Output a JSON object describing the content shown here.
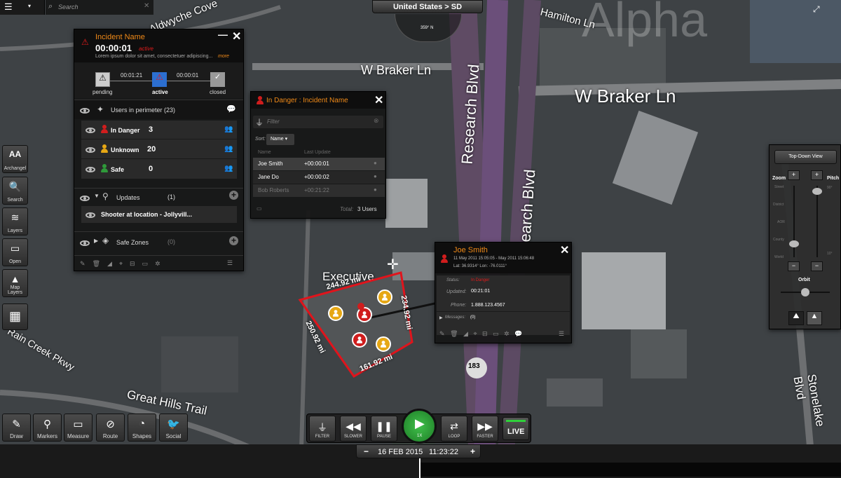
{
  "header": {
    "search_placeholder": "Search",
    "location": "United States > SD",
    "compass_heading": "359° N"
  },
  "map": {
    "watermark": "Alpha",
    "streets": [
      "Hamilton Ln",
      "W Braker Ln",
      "W Braker Ln",
      "Research Blvd",
      "Research Blvd",
      "Stonelake Blvd",
      "Great Hills Trail",
      "Rain Creek Pkwy",
      "Executive",
      "Aldwyche Cove"
    ],
    "highway_shield": "183",
    "perimeter_labels": [
      "244.92 mi",
      "234.92 mi",
      "250.92 mi",
      "161.92 mi"
    ]
  },
  "incident": {
    "title": "Incident Name",
    "timer": "00:00:01",
    "state": "active",
    "description": "Lorem ipsum dolor sit amet, consectetuer adipiscing...",
    "more_link": "more",
    "timeline": {
      "t1": "00:01:21",
      "t2": "00:00:01",
      "steps": [
        "pending",
        "active",
        "closed"
      ]
    },
    "users_label": "Users in perimeter",
    "users_count": "(23)",
    "categories": [
      {
        "label": "In Danger",
        "count": "3",
        "color": "#d01d1d"
      },
      {
        "label": "Unknown",
        "count": "20",
        "color": "#e6a714"
      },
      {
        "label": "Safe",
        "count": "0",
        "color": "#2f9a3a"
      }
    ],
    "updates_label": "Updates",
    "updates_count": "(1)",
    "update_item": "Shooter at location - Jollyvill...",
    "safe_zones_label": "Safe Zones",
    "safe_zones_count": "(0)"
  },
  "danger_panel": {
    "title": "In Danger : Incident Name",
    "filter_placeholder": "Filter",
    "sort_label": "Sort:",
    "sort_value": "Name",
    "col_name": "Name",
    "col_update": "Last Update",
    "rows": [
      {
        "name": "Joe Smith",
        "update": "+00:00:01"
      },
      {
        "name": "Jane Do",
        "update": "+00:00:02"
      },
      {
        "name": "Bob Roberts",
        "update": "+00:21:22"
      }
    ],
    "total_label": "Total:",
    "total_value": "3 Users"
  },
  "person_popup": {
    "name": "Joe Smith",
    "date_range": "11 May 2011 15:05:05 - May 2011 15:06:48",
    "coords": "Lat: 36.9314° Lon: -76.0111°",
    "status_label": "Status:",
    "status_value": "In Danger",
    "updated_label": "Updated:",
    "updated_value": "00:21:01",
    "phone_label": "Phone:",
    "phone_value": "1.888.123.4567",
    "messages_label": "Messages:",
    "messages_count": "(0)"
  },
  "left_toolbar": [
    {
      "icon": "AA",
      "label": "Archangel"
    },
    {
      "icon": "🔍",
      "label": "Search"
    },
    {
      "icon": "≋",
      "label": "Layers"
    },
    {
      "icon": "▭",
      "label": "Open"
    },
    {
      "icon": "▲",
      "label": "Map Layers"
    }
  ],
  "bottom_toolbar": [
    {
      "icon": "✎",
      "label": "Draw"
    },
    {
      "icon": "⚲",
      "label": "Markers"
    },
    {
      "icon": "▭",
      "label": "Measure"
    },
    {
      "icon": "⊘",
      "label": "Route"
    },
    {
      "icon": "◔",
      "label": "Shapes"
    },
    {
      "icon": "🐦",
      "label": "Social"
    }
  ],
  "playback": {
    "filter": "FILTER",
    "slower": "SLOWER",
    "pause": "PAUSE",
    "speed": "1X",
    "loop": "LOOP",
    "faster": "FASTER",
    "live": "LIVE",
    "date": "16 FEB 2015",
    "time": "11:23:22",
    "minus": "−",
    "plus": "+"
  },
  "view_panel": {
    "top_down": "Top-Down View",
    "zoom_label": "Zoom",
    "pitch_label": "Pitch",
    "zoom_levels": [
      "Street",
      "District",
      "AOR",
      "County",
      "World"
    ],
    "pitch_top": "90°",
    "pitch_bottom": "10°",
    "orbit_label": "Orbit"
  }
}
